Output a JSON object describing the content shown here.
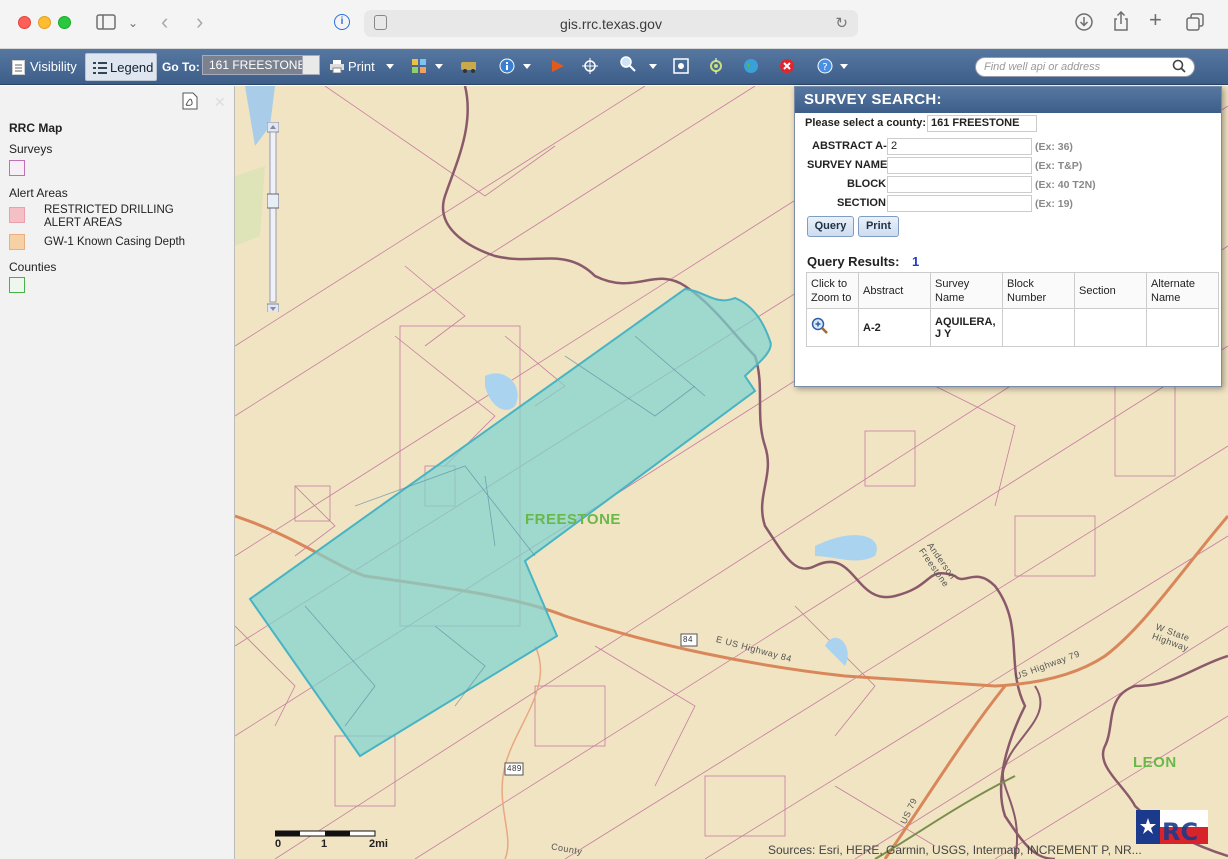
{
  "browser": {
    "url": "gis.rrc.texas.gov",
    "colors": {
      "close": "#fe5f57",
      "minimize": "#febc2e",
      "zoom": "#28c840"
    }
  },
  "toolbar": {
    "visibility_label": "Visibility",
    "legend_label": "Legend",
    "goto_label": "Go To:",
    "goto_value": "161 FREESTONE",
    "print_label": "Print",
    "search_placeholder": "Find well api or address",
    "icons": [
      "layers-icon",
      "basemap-icon",
      "identify-icon",
      "flag-icon",
      "crosshair-icon",
      "zoom-icon",
      "full-extent-icon",
      "locate-icon",
      "globe-icon",
      "clear-icon",
      "help-icon"
    ]
  },
  "legend": {
    "title": "RRC Map",
    "groups": [
      {
        "label": "Surveys",
        "items": [
          {
            "label": "",
            "color": "#c36fb8"
          }
        ]
      },
      {
        "label": "Alert Areas",
        "items": [
          {
            "label": "RESTRICTED DRILLING ALERT AREAS",
            "color": "#f4c0c6"
          },
          {
            "label": "GW-1 Known Casing Depth",
            "color": "#f7d1a6"
          }
        ]
      },
      {
        "label": "Counties",
        "items": [
          {
            "label": "",
            "color": "#4ab04a"
          }
        ]
      }
    ]
  },
  "survey_search": {
    "title": "SURVEY SEARCH:",
    "county_label": "Please select a county:",
    "county_value": "161 FREESTONE",
    "fields": [
      {
        "label": "ABSTRACT A-",
        "value": "2",
        "hint": "(Ex: 36)"
      },
      {
        "label": "SURVEY NAME",
        "value": "",
        "hint": "(Ex: T&P)"
      },
      {
        "label": "BLOCK",
        "value": "",
        "hint": "(Ex: 40 T2N)"
      },
      {
        "label": "SECTION",
        "value": "",
        "hint": "(Ex: 19)"
      }
    ],
    "query_button": "Query",
    "print_button": "Print",
    "results_label": "Query Results:",
    "results_count": "1",
    "columns": [
      "Click to Zoom to",
      "Abstract",
      "Survey Name",
      "Block Number",
      "Section",
      "Alternate Name"
    ],
    "rows": [
      {
        "abstract": "A-2",
        "survey_name": "AQUILERA, J Y",
        "block": "",
        "section": "",
        "alternate": ""
      }
    ]
  },
  "map": {
    "county_labels": [
      "FREESTONE",
      "LEON"
    ],
    "road_labels": [
      "E US Highway 84",
      "US Highway 79",
      "W State Highway",
      "Anderson Freestone",
      "84",
      "489",
      "US 79",
      "County"
    ],
    "scale_labels": [
      "0",
      "1",
      "2mi"
    ],
    "attribution": "Sources: Esri, HERE, Garmin, USGS, Intermap, INCREMENT P, NR...",
    "colors": {
      "highlight": "#7fd3d0",
      "survey_lines": "#b44e8c",
      "county_border": "#8a5a6a",
      "highway": "#d9875a"
    }
  }
}
